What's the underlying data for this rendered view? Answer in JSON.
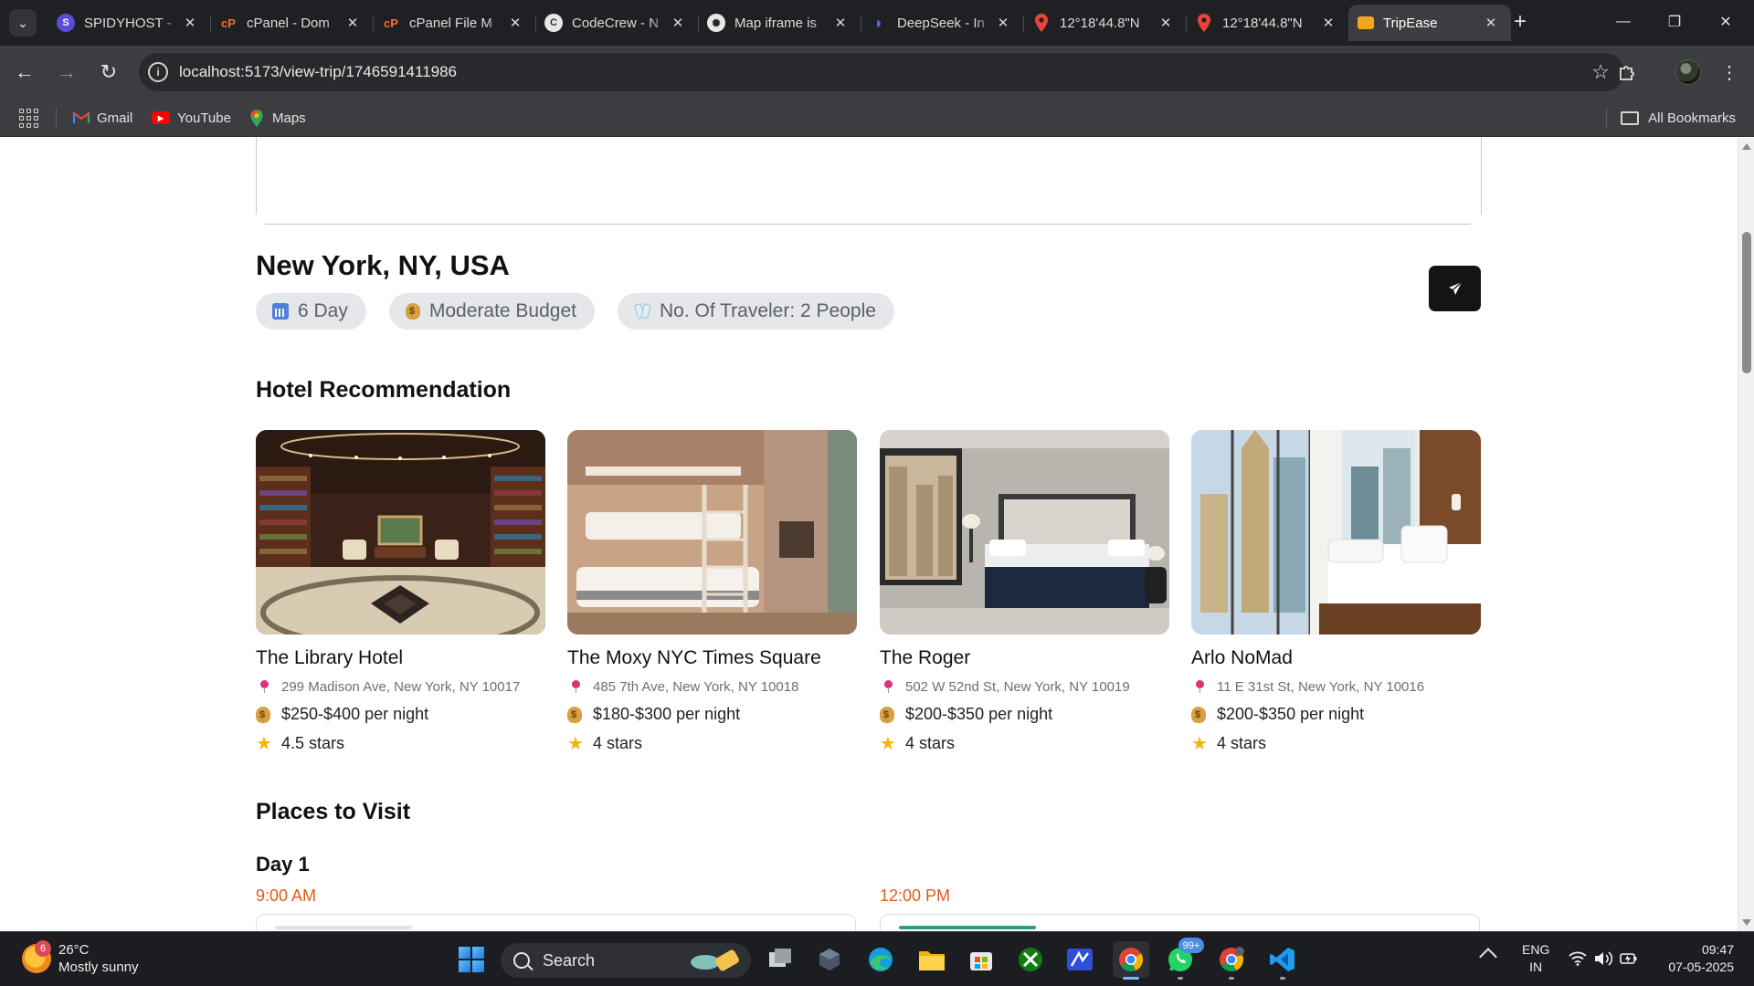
{
  "browser": {
    "tabs": [
      {
        "title": "SPIDYHOST - ",
        "favicon": "spidyhost-icon",
        "color": "#5b4bd6",
        "glyph": "S"
      },
      {
        "title": "cPanel - Dom",
        "favicon": "cpanel-icon",
        "color": "#ff6c2c",
        "glyph": "cP"
      },
      {
        "title": "cPanel File M",
        "favicon": "cpanel-icon",
        "color": "#ff6c2c",
        "glyph": "cP"
      },
      {
        "title": "CodeCrew - N",
        "favicon": "codecrew-icon",
        "color": "#9a9a9a",
        "glyph": "C"
      },
      {
        "title": "Map iframe is",
        "favicon": "openai-icon",
        "color": "#9a9a9a",
        "glyph": "✺"
      },
      {
        "title": "DeepSeek - In",
        "favicon": "deepseek-icon",
        "color": "#4d6bfe",
        "glyph": "◗"
      },
      {
        "title": "12°18'44.8\"N",
        "favicon": "maps-pin-icon",
        "color": "#34a853",
        "glyph": "⬤"
      },
      {
        "title": "12°18'44.8\"N",
        "favicon": "maps-pin-icon",
        "color": "#34a853",
        "glyph": "⬤"
      },
      {
        "title": "TripEase",
        "favicon": "tripease-icon",
        "color": "#f4a522",
        "glyph": "▰"
      }
    ],
    "url": "localhost:5173/view-trip/1746591411986",
    "bookmarks": [
      {
        "label": "Gmail",
        "icon": "gmail-icon"
      },
      {
        "label": "YouTube",
        "icon": "youtube-icon"
      },
      {
        "label": "Maps",
        "icon": "maps-icon"
      }
    ],
    "all_bookmarks": "All Bookmarks"
  },
  "trip": {
    "destination": "New York, NY, USA",
    "chips": [
      {
        "label": "6 Day",
        "icon": "calendar-icon"
      },
      {
        "label": "Moderate Budget",
        "icon": "money-bag-icon"
      },
      {
        "label": "No. Of Traveler: 2 People",
        "icon": "cheers-icon"
      }
    ],
    "share_icon": "send-icon"
  },
  "hotels": {
    "title": "Hotel Recommendation",
    "items": [
      {
        "name": "The Library Hotel",
        "address": "299 Madison Ave, New York, NY 10017",
        "price": "$250-$400 per night",
        "rating": "4.5 stars"
      },
      {
        "name": "The Moxy NYC Times Square",
        "address": "485 7th Ave, New York, NY 10018",
        "price": "$180-$300 per night",
        "rating": "4 stars"
      },
      {
        "name": "The Roger",
        "address": "502 W 52nd St, New York, NY 10019",
        "price": "$200-$350 per night",
        "rating": "4 stars"
      },
      {
        "name": "Arlo NoMad",
        "address": "11 E 31st St, New York, NY 10016",
        "price": "$200-$350 per night",
        "rating": "4 stars"
      }
    ]
  },
  "places": {
    "title": "Places to Visit",
    "day": "Day 1",
    "times": [
      "9:00 AM",
      "12:00 PM"
    ]
  },
  "taskbar": {
    "weather_temp": "26°C",
    "weather_desc": "Mostly sunny",
    "weather_badge": "6",
    "search_label": "Search",
    "whatsapp_badge": "99+",
    "lang_top": "ENG",
    "lang_bottom": "IN",
    "time": "09:47",
    "date": "07-05-2025"
  },
  "colors": {
    "time_accent": "#e05a1a",
    "chip_bg": "#e5e7eb",
    "share_button": "#141414"
  }
}
